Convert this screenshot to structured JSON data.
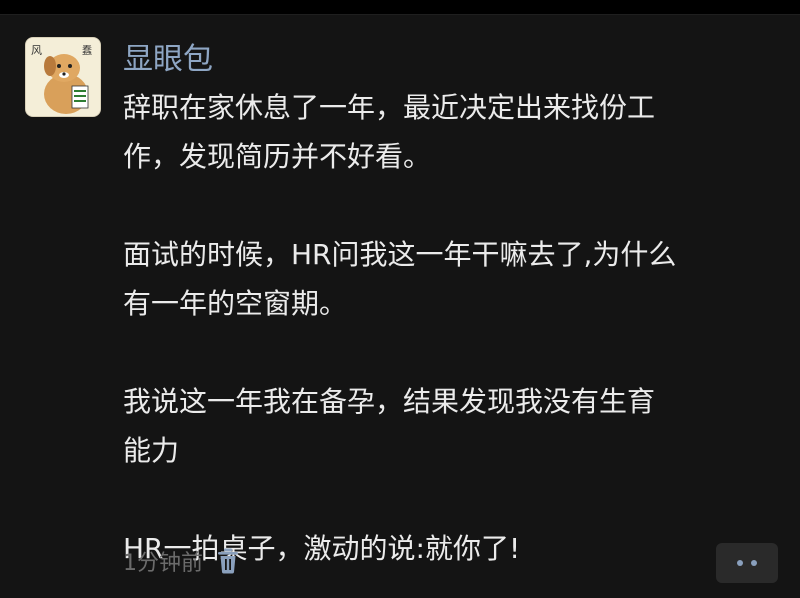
{
  "post": {
    "author": "显眼包",
    "paragraphs": [
      [
        "辞职在家休息了一年，最近决定出来找份工",
        "作，发现简历并不好看。"
      ],
      [
        "面试的时候，HR问我这一年干嘛去了,为什么",
        "有一年的空窗期。"
      ],
      [
        "我说这一年我在备孕，结果发现我没有生育",
        "能力"
      ],
      [
        "HR一拍桌子，激动的说:就你了!"
      ]
    ],
    "timestamp": "1分钟前"
  },
  "avatar": {
    "top_left_text": "风",
    "top_right_text": "蠢"
  },
  "icons": {
    "delete": "trash-icon",
    "more": "more-dots-icon"
  },
  "colors": {
    "background": "#141414",
    "username": "#8ea6c4",
    "text": "#ebebeb",
    "meta": "#6b6b6b",
    "more_button_bg": "#2a2a2a",
    "more_dots": "#8aa0bd"
  }
}
